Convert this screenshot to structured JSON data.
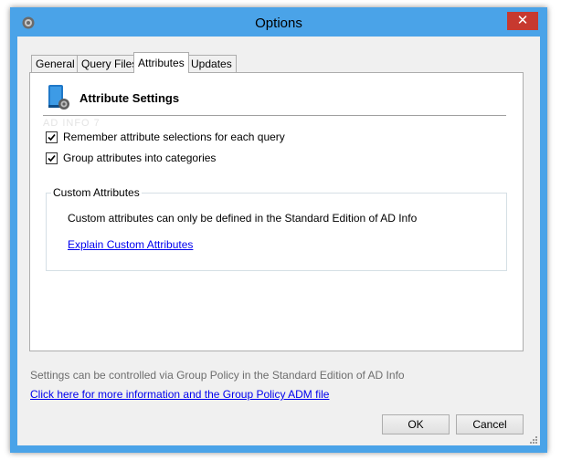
{
  "window": {
    "title": "Options",
    "close_glyph": "✕",
    "accent_color": "#4aa3e8",
    "close_color": "#c7392f",
    "app_icon": "gear-icon"
  },
  "tabs": [
    {
      "label": "General",
      "active": false
    },
    {
      "label": "Query Files",
      "active": false
    },
    {
      "label": "Attributes",
      "active": true
    },
    {
      "label": "Updates",
      "active": false
    }
  ],
  "panel": {
    "header_title": "Attribute Settings",
    "header_icon": "book-gear-icon",
    "ghost_text": "AD INFO 7",
    "checkboxes": [
      {
        "label": "Remember attribute selections for each query",
        "checked": true
      },
      {
        "label": "Group attributes into categories",
        "checked": true
      }
    ],
    "custom": {
      "legend": "Custom Attributes",
      "text": "Custom attributes can only be defined in the Standard Edition of AD Info",
      "link": "Explain Custom Attributes"
    }
  },
  "footer": {
    "note": "Settings can be controlled via Group Policy in the Standard Edition of AD Info",
    "link": "Click here for more information and the Group Policy ADM file",
    "ok_label": "OK",
    "cancel_label": "Cancel"
  }
}
